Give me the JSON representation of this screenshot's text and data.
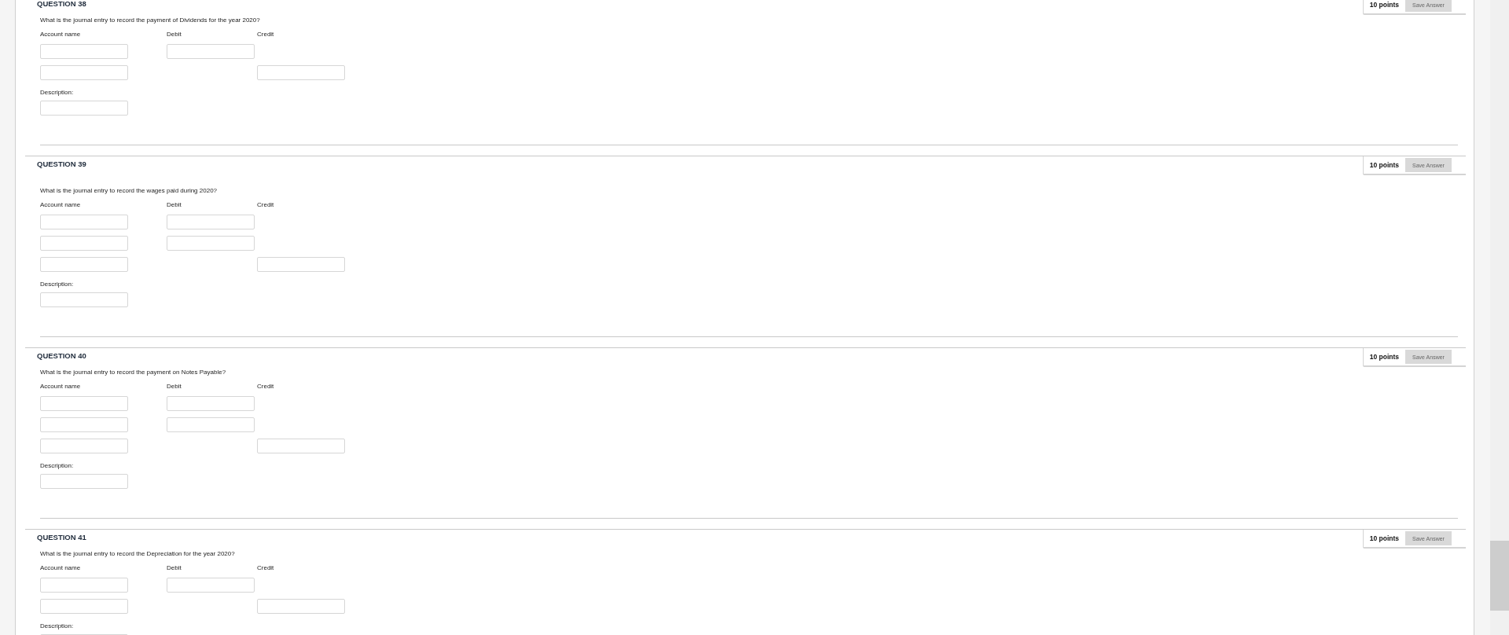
{
  "questions": [
    {
      "title": "QUESTION 38",
      "points": "10 points",
      "save_button": "Save Answer",
      "prompt": "What is the journal entry to record the payment of Dividends for the year 2020?",
      "columns": [
        "Account name",
        "Debit",
        "Credit"
      ],
      "rows": [
        {
          "kind": "debit"
        },
        {
          "kind": "credit"
        }
      ],
      "description_label": "Description:"
    },
    {
      "title": "QUESTION 39",
      "points": "10 points",
      "save_button": "Save Answer",
      "prompt": "What is the journal entry to record the wages paid during 2020?",
      "columns": [
        "Account name",
        "Debit",
        "Credit"
      ],
      "rows": [
        {
          "kind": "debit"
        },
        {
          "kind": "debit"
        },
        {
          "kind": "credit"
        }
      ],
      "description_label": "Description:"
    },
    {
      "title": "QUESTION 40",
      "points": "10 points",
      "save_button": "Save Answer",
      "prompt": "What is the journal entry to record the payment on Notes Payable?",
      "columns": [
        "Account name",
        "Debit",
        "Credit"
      ],
      "rows": [
        {
          "kind": "debit"
        },
        {
          "kind": "debit"
        },
        {
          "kind": "credit"
        }
      ],
      "description_label": "Description:"
    },
    {
      "title": "QUESTION 41",
      "points": "10 points",
      "save_button": "Save Answer",
      "prompt": "What is the journal entry to record the Depreciation for the year 2020?",
      "columns": [
        "Account name",
        "Debit",
        "Credit"
      ],
      "rows": [
        {
          "kind": "debit"
        },
        {
          "kind": "credit"
        }
      ],
      "description_label": "Description:"
    }
  ]
}
